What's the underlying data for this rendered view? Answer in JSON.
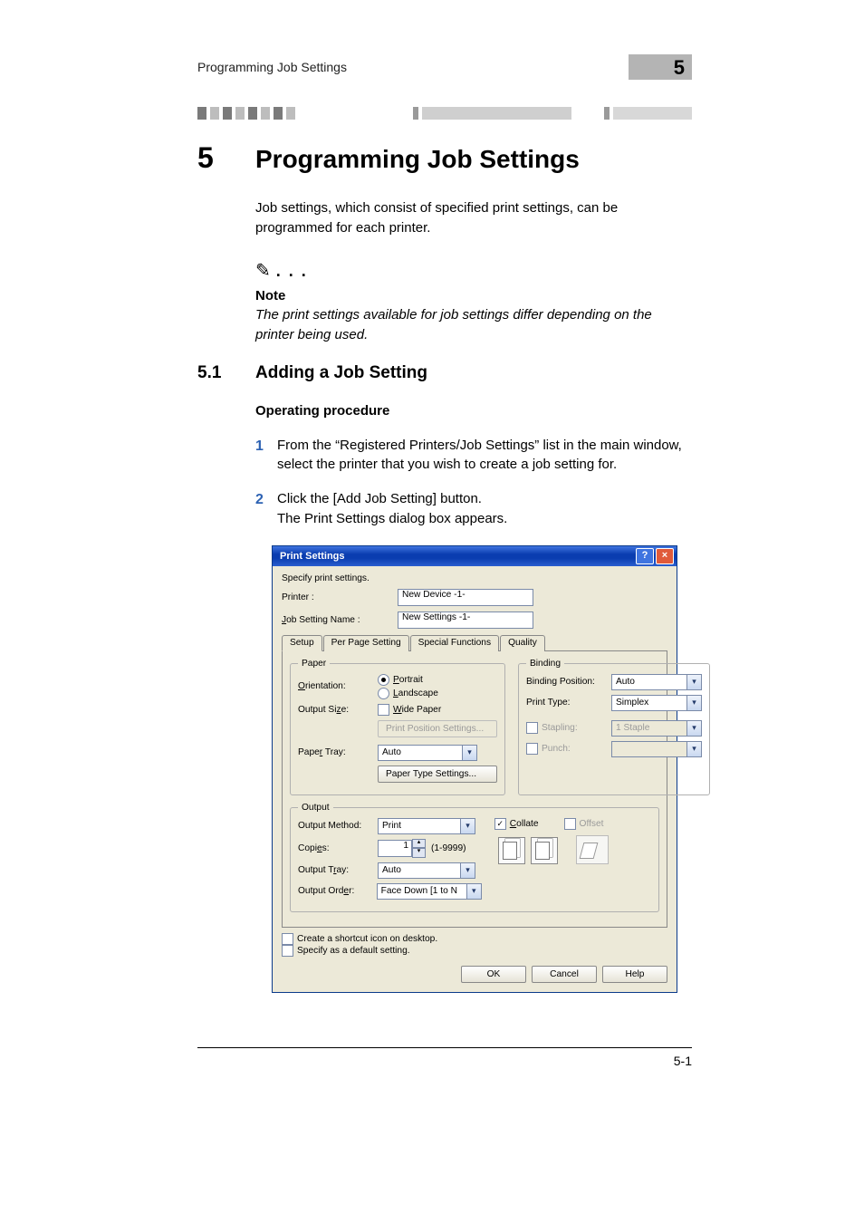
{
  "running_header": {
    "text": "Programming Job Settings",
    "chapter_badge": "5"
  },
  "chapter": {
    "number": "5",
    "title": "Programming Job Settings"
  },
  "intro_para": "Job settings, which consist of specified print settings, can be programmed for each printer.",
  "note": {
    "label": "Note",
    "text": "The print settings available for job settings differ depending on the printer being used."
  },
  "section": {
    "number": "5.1",
    "title": "Adding a Job Setting"
  },
  "sub_heading": "Operating procedure",
  "steps": {
    "one": {
      "num": "1",
      "text": "From the “Registered Printers/Job Settings” list in the main window, select the printer that you wish to create a job setting for."
    },
    "two": {
      "num": "2",
      "text_line1": "Click the [Add Job Setting] button.",
      "text_line2": "The Print Settings dialog box appears."
    }
  },
  "dialog": {
    "title": "Print Settings",
    "help_btn": "?",
    "close_btn": "×",
    "instruction": "Specify print settings.",
    "printer_label": "Printer :",
    "printer_value": "New Device -1-",
    "jobname_label_pre": "J",
    "jobname_label_post": "ob Setting Name :",
    "jobname_value": "New Settings -1-",
    "tabs": {
      "setup": "Setup",
      "perpage": "Per Page Setting",
      "special": "Special Functions",
      "quality": "Quality"
    },
    "paper": {
      "legend": "Paper",
      "orientation_label_pre": "O",
      "orientation_label_post": "rientation:",
      "portrait_pre": "P",
      "portrait_post": "ortrait",
      "landscape_pre": "L",
      "landscape_post": "andscape",
      "outputsize_label": "Output Si",
      "outputsize_ul": "z",
      "outputsize_post": "e:",
      "wide_pre": "W",
      "wide_post": "ide Paper",
      "printpos_btn": "Print Position Settings...",
      "papertray_label": "Pape",
      "papertray_ul": "r",
      "papertray_post": " Tray:",
      "papertray_value": "Auto",
      "papertype_btn": "Paper Type Settings..."
    },
    "binding": {
      "legend": "Binding",
      "pos_label": "Binding Position:",
      "pos_value": "Auto",
      "type_label": "Print Type:",
      "type_value": "Simplex",
      "stapling_label": "Stapling:",
      "stapling_value": "1 Staple",
      "punch_label": "Punch:"
    },
    "output": {
      "legend": "Output",
      "method_label": "Output Method:",
      "method_value": "Print",
      "copies_label": "Copies:",
      "copies_label_ul": "e",
      "copies_range": "(1-9999)",
      "copies_value": "1",
      "tray_label": "Output T",
      "tray_ul": "r",
      "tray_post": "ay:",
      "tray_value": "Auto",
      "order_label": "Output Ord",
      "order_ul": "e",
      "order_post": "r:",
      "order_value": "Face Down [1 to N",
      "collate_pre": "C",
      "collate_post": "ollate",
      "offset_label": "Offset"
    },
    "bottom": {
      "shortcut": "Create a shortcut icon on desktop.",
      "default": "Specify as a default setting."
    },
    "buttons": {
      "ok": "OK",
      "cancel": "Cancel",
      "help": "Help"
    }
  },
  "footer": {
    "page_num": "5-1"
  }
}
